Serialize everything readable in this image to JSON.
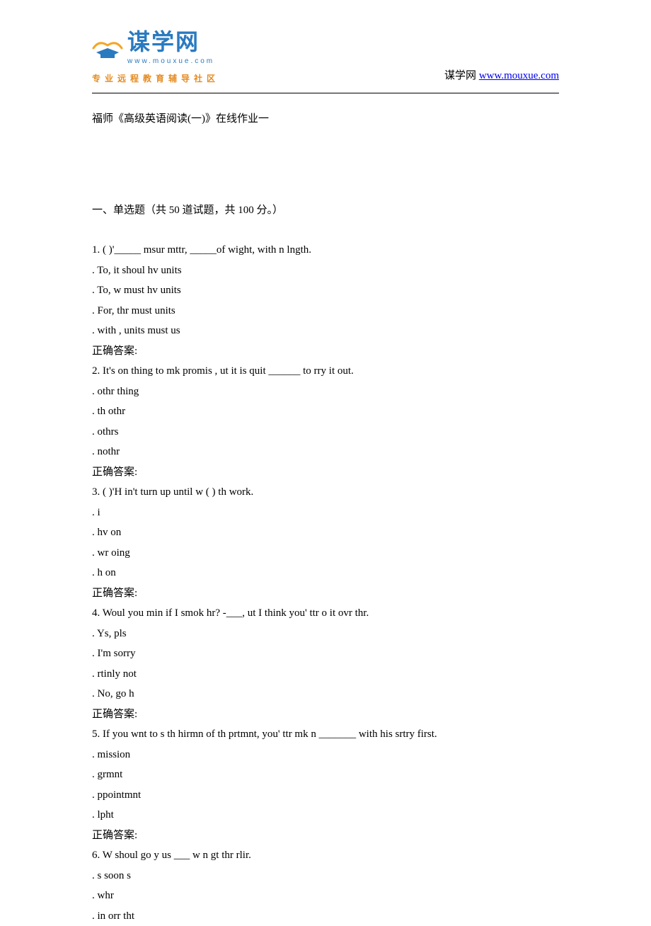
{
  "header": {
    "logo_cn": "谋学网",
    "logo_pinyin": "www.mouxue.com",
    "logo_sub": "专业远程教育辅导社区",
    "right_prefix": "谋学网 ",
    "right_link_text": "www.mouxue.com"
  },
  "title": "福师《高级英语阅读(一)》在线作业一",
  "section_heading": "一、单选题（共 50 道试题，共 100 分。）",
  "answer_label": "正确答案:",
  "questions": [
    {
      "stem": "1.  ( )'_____ msur mttr, _____of wight, with n lngth.",
      "options": [
        ". To, it shoul hv units",
        ". To, w must hv units",
        ". For, thr must  units",
        ". with , units must  us"
      ]
    },
    {
      "stem": "2.  It's on thing to mk  promis , ut it is quit ______ to rry it out.",
      "options": [
        ". othr thing",
        ". th othr",
        ". othrs",
        ". nothr"
      ]
    },
    {
      "stem": "3.  ( )'H in't turn up until w ( ) th work.",
      "options": [
        ". i",
        ". hv on",
        ". wr oing",
        ". h on"
      ]
    },
    {
      "stem": "4.  Woul you min if I smok hr? -___, ut I think you' ttr o it ovr thr.",
      "options": [
        ". Ys, pls",
        ". I'm sorry",
        ". rtinly not",
        ". No, go h"
      ]
    },
    {
      "stem": "5.  If you wnt to s th hirmn of th prtmnt, you' ttr mk n _______ with his srtry first.",
      "options": [
        ". mission",
        ". grmnt",
        ". ppointmnt",
        ". lpht"
      ]
    },
    {
      "stem": "6.  W shoul go y us ___ w n gt thr rlir.",
      "options": [
        ". s soon s",
        ". whr",
        ". in orr tht"
      ]
    }
  ]
}
